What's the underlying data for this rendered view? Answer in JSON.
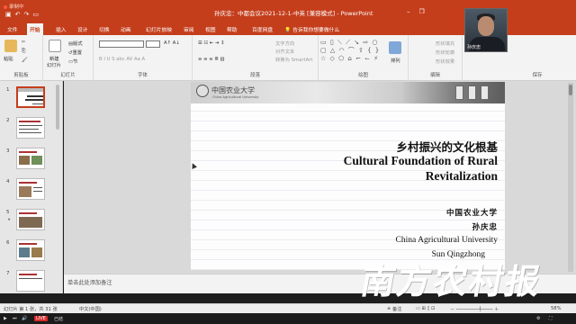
{
  "titlebar": {
    "recording": "录制中",
    "title": "孙庆忠：中都会议2021-12-1-中英 [兼容模式] - PowerPoint",
    "account_suffix": "ue"
  },
  "tabs": [
    "文件",
    "开始",
    "插入",
    "设计",
    "切换",
    "动画",
    "幻灯片放映",
    "审阅",
    "视图",
    "帮助",
    "百度网盘",
    "告诉我你想要做什么"
  ],
  "ribbon": {
    "clipboard": {
      "label": "剪贴板",
      "paste": "粘贴"
    },
    "slides": {
      "label": "幻灯片",
      "new_slide": "新建",
      "new_slide2": "幻灯片",
      "layout": "版式",
      "reset": "重置",
      "section": "节"
    },
    "font": {
      "label": "字体",
      "buttons": "B  I  U  S  abc  AV  Aa  A"
    },
    "paragraph": {
      "label": "段落",
      "text_direction": "文字方向",
      "align_text": "对齐文本",
      "smartart": "转换为 SmartArt"
    },
    "drawing": {
      "label": "绘图",
      "arrange": "排列"
    },
    "editing": {
      "label": "编辑"
    },
    "save": {
      "label": "保存"
    },
    "right_buttons": [
      "形状填充",
      "形状轮廓",
      "形状效果"
    ]
  },
  "webcam": {
    "name": "孙庆忠"
  },
  "thumbnails": {
    "items": [
      {
        "num": "1",
        "selected": true
      },
      {
        "num": "2",
        "selected": false
      },
      {
        "num": "3",
        "selected": false
      },
      {
        "num": "4",
        "selected": false
      },
      {
        "num": "5",
        "selected": false
      },
      {
        "num": "6",
        "selected": false
      },
      {
        "num": "7",
        "selected": false
      }
    ]
  },
  "slide": {
    "banner_name": "中国农业大学",
    "banner_en": "China Agricultural University",
    "title_cn": "乡村振兴的文化根基",
    "title_en_line1": "Cultural Foundation of Rural",
    "title_en_line2": "Revitalization",
    "university_cn": "中国农业大学",
    "author_cn": "孙庆忠",
    "university_en": "China Agricultural University",
    "author_en": "Sun Qingzhong"
  },
  "notes": {
    "placeholder": "单击此处添加备注"
  },
  "watermark": "南方农村报",
  "statusbar": {
    "slide_info": "幻灯片 第 1 张，共 31 张",
    "language": "中文(中国)",
    "notes_btn": "备注",
    "zoom": "58%"
  },
  "player": {
    "live": "LIVE",
    "time": "已结"
  }
}
